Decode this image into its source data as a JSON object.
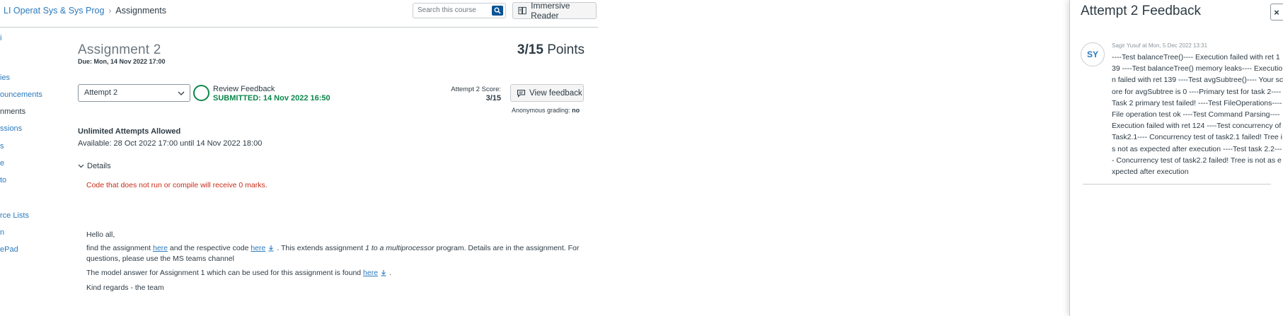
{
  "breadcrumb": {
    "course": "LI Operat Sys & Sys Prog",
    "current": "Assignments"
  },
  "search": {
    "placeholder": "Search this course"
  },
  "toolbar": {
    "immersive_reader": "Immersive Reader"
  },
  "course_nav": {
    "items": [
      {
        "label": "ies",
        "active": false
      },
      {
        "label": "ouncements",
        "active": false
      },
      {
        "label": "nments",
        "active": true
      },
      {
        "label": "ssions",
        "active": false
      },
      {
        "label": "s",
        "active": false
      },
      {
        "label": "e",
        "active": false
      },
      {
        "label": "to",
        "active": false
      },
      {
        "label": "rce Lists",
        "active": false
      },
      {
        "label": "n",
        "active": false
      },
      {
        "label": "ePad",
        "active": false
      }
    ]
  },
  "assignment": {
    "title": "Assignment 2",
    "due": "Due: Mon, 14 Nov 2022 17:00",
    "points_score": "3/15",
    "points_label": "Points",
    "attempt_selected": "Attempt 2",
    "review_feedback": "Review Feedback",
    "submitted": "SUBMITTED: 14 Nov 2022 16:50",
    "attempt_score_label": "Attempt 2 Score:",
    "attempt_score_value": "3/15",
    "view_feedback": "View feedback",
    "anonymous_label": "Anonymous grading:",
    "anonymous_value": "no",
    "attempts_allowed": "Unlimited Attempts Allowed",
    "available": "Available: 28 Oct 2022 17:00 until 14 Nov 2022 18:00",
    "details_label": "Details",
    "warning": "Code that does not run or compile will receive 0 marks."
  },
  "description": {
    "greeting": "Hello all,",
    "p1_a": "find the assignment",
    "p1_link1": "here",
    "p1_b": "and the respective code",
    "p1_link2": "here",
    "p1_c": ". This extends assignment",
    "p1_em": "1 to a multiprocessor",
    "p1_d": "program. Details are in the assignment. For questions, please use the MS teams channel",
    "p2_a": "The model answer for Assignment 1 which can be used for this assignment is found",
    "p2_link": "here",
    "p2_b": ".",
    "signoff": "Kind regards - the team"
  },
  "feedback_panel": {
    "title": "Attempt 2 Feedback",
    "close": "×",
    "avatar_initials": "SY",
    "comment_meta": "Sagir Yusuf at Mon, 5 Dec 2022 13:31",
    "comment_text": "----Test balanceTree()---- Execution failed with ret 139 ----Test balanceTree() memory leaks---- Execution failed with ret 139 ----Test avgSubtree()---- Your score for avgSubtree is 0 ----Primary test for task 2---- Task 2 primary test failed! ----Test FileOperations---- File operation test ok ----Test Command Parsing---- Execution failed with ret 124 ----Test concurrency of Task2.1---- Concurrency test of task2.1 failed! Tree is not as expected after execution ----Test task 2.2---- Concurrency test of task2.2 failed! Tree is not as expected after execution"
  },
  "icons": {
    "search": "search-icon",
    "immersive_reader": "immersive-reader-icon",
    "chevron": "chevron-down-icon",
    "view_feedback": "comment-icon",
    "download": "download-icon"
  },
  "colors": {
    "link": "#2b7abc",
    "success": "#0b874b",
    "warning": "#c92b18",
    "search_button": "#0b5394"
  }
}
